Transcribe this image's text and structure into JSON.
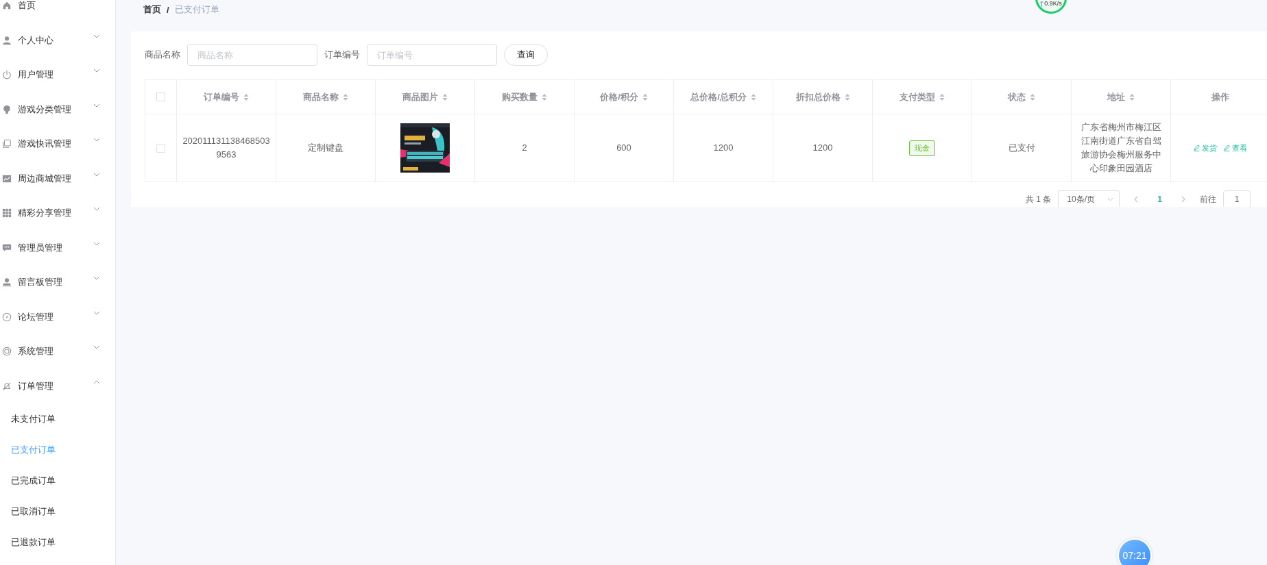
{
  "sidebar": {
    "items": [
      {
        "label": "首页",
        "has_children": false
      },
      {
        "label": "个人中心",
        "has_children": true,
        "expanded": false
      },
      {
        "label": "用户管理",
        "has_children": true,
        "expanded": false
      },
      {
        "label": "游戏分类管理",
        "has_children": true,
        "expanded": false
      },
      {
        "label": "游戏快讯管理",
        "has_children": true,
        "expanded": false
      },
      {
        "label": "周边商城管理",
        "has_children": true,
        "expanded": false
      },
      {
        "label": "精彩分享管理",
        "has_children": true,
        "expanded": false
      },
      {
        "label": "管理员管理",
        "has_children": true,
        "expanded": false
      },
      {
        "label": "留言板管理",
        "has_children": true,
        "expanded": false
      },
      {
        "label": "论坛管理",
        "has_children": true,
        "expanded": false
      },
      {
        "label": "系统管理",
        "has_children": true,
        "expanded": false
      },
      {
        "label": "订单管理",
        "has_children": true,
        "expanded": true,
        "children": [
          {
            "label": "未支付订单",
            "selected": false
          },
          {
            "label": "已支付订单",
            "selected": true
          },
          {
            "label": "已完成订单",
            "selected": false
          },
          {
            "label": "已取消订单",
            "selected": false
          },
          {
            "label": "已退款订单",
            "selected": false
          }
        ]
      }
    ]
  },
  "breadcrumb": {
    "items": [
      "首页",
      "已支付订单"
    ],
    "separator": "/"
  },
  "speed_widget": {
    "reading": "0.9K/s"
  },
  "search": {
    "fields": [
      {
        "label": "商品名称",
        "placeholder": "商品名称"
      },
      {
        "label": "订单编号",
        "placeholder": "订单编号"
      }
    ],
    "button": "查询"
  },
  "table": {
    "all_checked": false,
    "columns": [
      {
        "label": "订单编号",
        "sortable": true
      },
      {
        "label": "商品名称",
        "sortable": true
      },
      {
        "label": "商品图片",
        "sortable": true
      },
      {
        "label": "购买数量",
        "sortable": true
      },
      {
        "label": "价格/积分",
        "sortable": true
      },
      {
        "label": "总价格/总积分",
        "sortable": true
      },
      {
        "label": "折扣总价格",
        "sortable": true
      },
      {
        "label": "支付类型",
        "sortable": true
      },
      {
        "label": "状态",
        "sortable": true
      },
      {
        "label": "地址",
        "sortable": true
      },
      {
        "label": "操作",
        "sortable": false
      }
    ],
    "rows": [
      {
        "checked": false,
        "cells": [
          {
            "kind": "text",
            "text": "2020111311384685039563"
          },
          {
            "kind": "text",
            "text": "定制键盘"
          },
          {
            "kind": "picture"
          },
          {
            "kind": "text",
            "text": "2"
          },
          {
            "kind": "text",
            "text": "600"
          },
          {
            "kind": "text",
            "text": "1200"
          },
          {
            "kind": "text",
            "text": "1200"
          },
          {
            "kind": "tag",
            "text": "现金",
            "color": "#67c23a"
          },
          {
            "kind": "text",
            "text": "已支付"
          },
          {
            "kind": "text",
            "text": "广东省梅州市梅江区江南街道广东省自驾旅游协会梅州服务中心印象田园酒店"
          },
          {
            "kind": "actions",
            "actions": [
              "发货",
              "查看"
            ]
          }
        ]
      }
    ]
  },
  "pagination": {
    "total": "共 1 条",
    "page_size": "10条/页",
    "pages": [
      {
        "label": "1",
        "selected": true
      }
    ],
    "goto_label": "前往",
    "goto_value": "1"
  },
  "clock": {
    "time": "07:21"
  }
}
